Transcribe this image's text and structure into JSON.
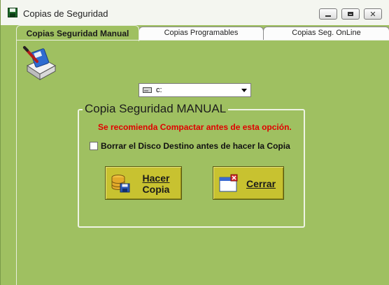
{
  "window": {
    "title": "Copias de Seguridad"
  },
  "tabs": [
    {
      "label": "Copias Seguridad Manual",
      "active": true
    },
    {
      "label": "Copias Programables",
      "active": false
    },
    {
      "label": "Copias Seg. OnLine",
      "active": false
    }
  ],
  "drive": {
    "selected": "c:",
    "icon": "drive-icon"
  },
  "group": {
    "title": "Copia Seguridad MANUAL",
    "warning": "Se recomienda Compactar antes de esta opción.",
    "wipe_checkbox_label": "Borrar el Disco Destino antes de hacer la Copia",
    "wipe_checked": false
  },
  "buttons": {
    "hacer_line1": "Hacer",
    "hacer_line2": "Copia",
    "cerrar": "Cerrar"
  },
  "colors": {
    "background": "#9fc061",
    "button": "#c8c230",
    "warning": "#e00000"
  }
}
